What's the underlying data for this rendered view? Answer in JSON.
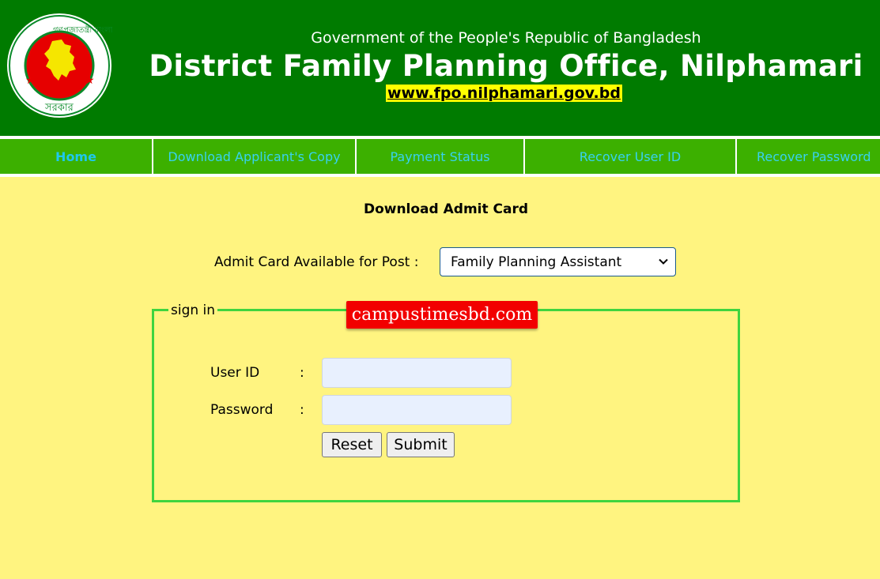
{
  "header": {
    "government": "Government of the People's Republic of Bangladesh",
    "office": "District Family Planning Office, Nilphamari",
    "website": "www.fpo.nilphamari.gov.bd",
    "logo_text_top": "গণপ্রজাতন্ত্রী বাংলাদেশ",
    "logo_text_bottom": "সরকার"
  },
  "nav": {
    "items": [
      {
        "label": "Home"
      },
      {
        "label": "Download Applicant's Copy"
      },
      {
        "label": "Payment Status"
      },
      {
        "label": "Recover User ID"
      },
      {
        "label": "Recover Password"
      }
    ]
  },
  "main": {
    "title": "Download Admit Card",
    "post_label": "Admit Card Available for Post :",
    "post_selected": "Family Planning Assistant"
  },
  "signin": {
    "legend": "sign in",
    "user_id_label": "User ID",
    "password_label": "Password",
    "colon": ":",
    "user_id_value": "",
    "password_value": "",
    "reset_label": "Reset",
    "submit_label": "Submit"
  },
  "watermark": "campustimesbd.com",
  "colors": {
    "header_bg": "#007b00",
    "nav_bg": "#3cb000",
    "page_bg": "#fff480",
    "watermark_bg": "#f20000"
  }
}
